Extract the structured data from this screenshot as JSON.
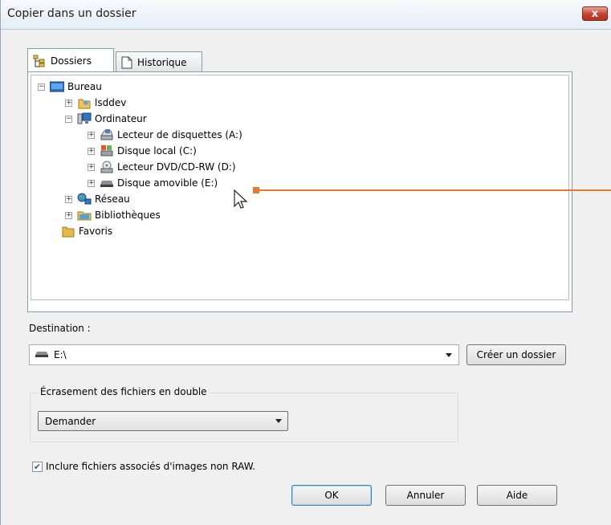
{
  "window": {
    "title": "Copier dans un dossier",
    "close_glyph": "x"
  },
  "tabs": [
    {
      "label": "Dossiers",
      "icon": "folder-tree-icon",
      "active": true
    },
    {
      "label": "Historique",
      "icon": "history-page-icon",
      "active": false
    }
  ],
  "tree": {
    "items": [
      {
        "label": "Bureau",
        "icon": "desktop-icon",
        "expander": "−"
      },
      {
        "label": "lsddev",
        "icon": "user-folder-icon",
        "expander": "+"
      },
      {
        "label": "Ordinateur",
        "icon": "computer-icon",
        "expander": "−"
      },
      {
        "label": "Lecteur de disquettes (A:)",
        "icon": "floppy-drive-icon",
        "expander": "+"
      },
      {
        "label": "Disque local (C:)",
        "icon": "hard-disk-icon",
        "expander": "+"
      },
      {
        "label": "Lecteur DVD/CD-RW (D:)",
        "icon": "dvd-drive-icon",
        "expander": "+"
      },
      {
        "label": "Disque amovible (E:)",
        "icon": "removable-disk-icon",
        "expander": "+"
      },
      {
        "label": "Réseau",
        "icon": "network-icon",
        "expander": "+"
      },
      {
        "label": "Bibliothèques",
        "icon": "libraries-icon",
        "expander": "+"
      },
      {
        "label": "Favoris",
        "icon": "favorites-folder-icon",
        "expander": ""
      }
    ]
  },
  "destination": {
    "label": "Destination :",
    "value": "E:\\",
    "create_folder_label": "Créer un dossier"
  },
  "overwrite": {
    "group_title": "Écrasement des fichiers en double",
    "selected": "Demander"
  },
  "include_checkbox": {
    "label": "Inclure fichiers associés d'images non RAW.",
    "checked": true
  },
  "buttons": {
    "ok": "OK",
    "cancel": "Annuler",
    "help": "Aide"
  },
  "colors": {
    "callout": "#e8782a",
    "close_button": "#c6402c"
  }
}
